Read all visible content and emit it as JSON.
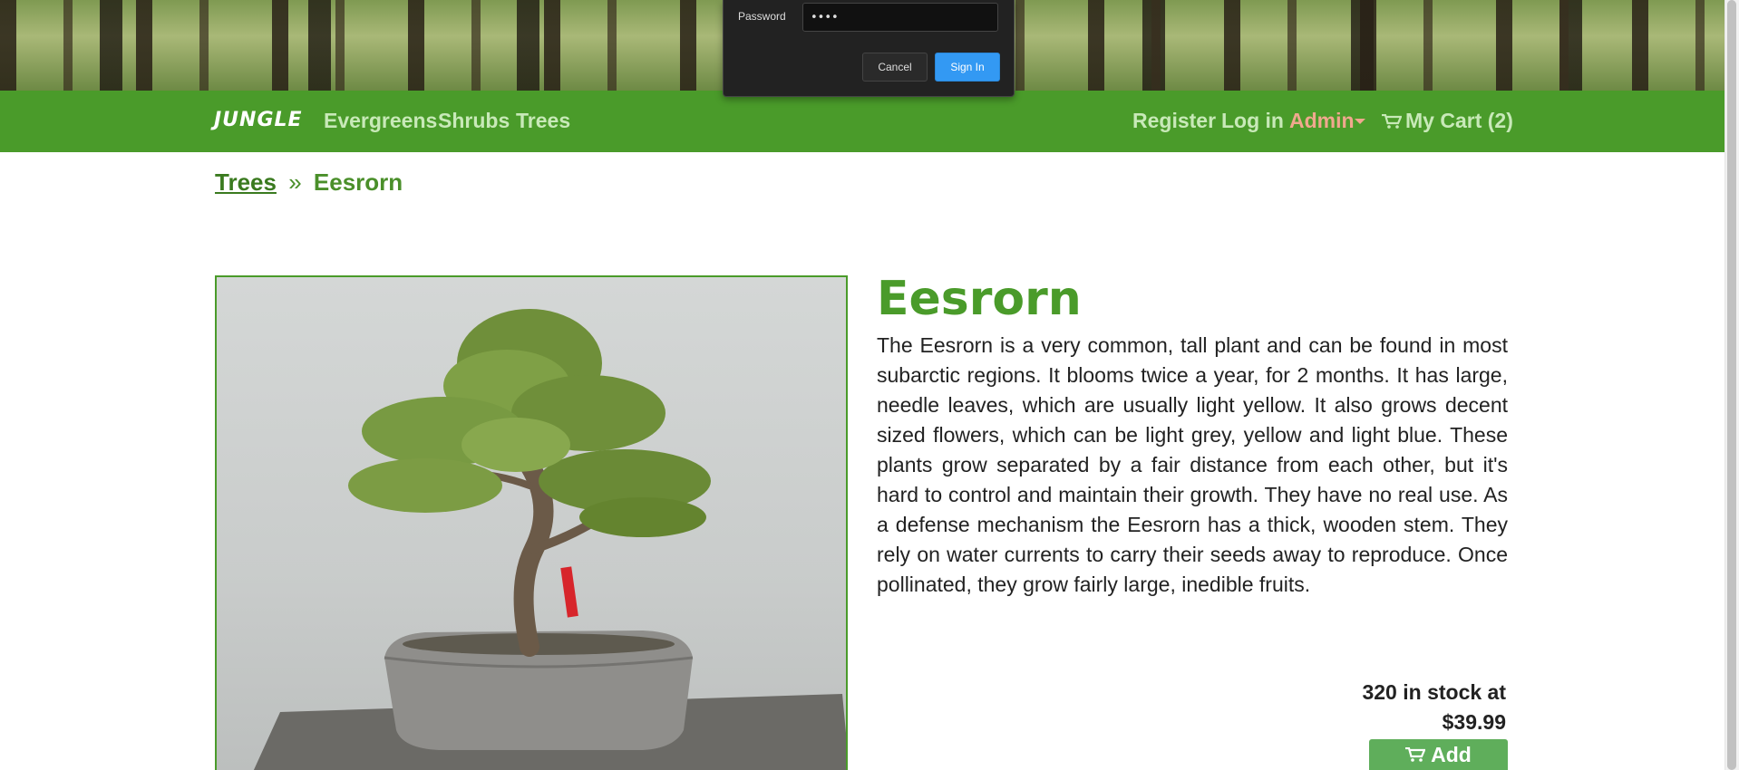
{
  "signin": {
    "password_label": "Password",
    "password_value": "••••",
    "cancel_label": "Cancel",
    "signin_label": "Sign In",
    "accent_color": "#3399f3"
  },
  "navbar": {
    "brand": "JUNGLE",
    "background_color": "#4a9b2a",
    "links": [
      "Evergreens",
      "Shrubs",
      "Trees"
    ],
    "register": "Register",
    "login": "Log in",
    "admin": "Admin",
    "cart": "My Cart (2)"
  },
  "breadcrumb": {
    "parent": "Trees",
    "separator": "»",
    "current": "Eesrorn"
  },
  "product": {
    "title": "Eesrorn",
    "description": "The Eesrorn is a very common, tall plant and can be found in most subarctic regions. It blooms twice a year, for 2 months. It has large, needle leaves, which are usually light yellow. It also grows decent sized flowers, which can be light grey, yellow and light blue. These plants grow separated by a fair distance from each other, but it's hard to control and maintain their growth. They have no real use. As a defense mechanism the Eesrorn has a thick, wooden stem. They rely on water currents to carry their seeds away to reproduce. Once pollinated, they grow fairly large, inedible fruits.",
    "stock_text": "320 in stock at",
    "price": "$39.99",
    "add_label": "Add",
    "image_subject": "bonsai-tree"
  }
}
